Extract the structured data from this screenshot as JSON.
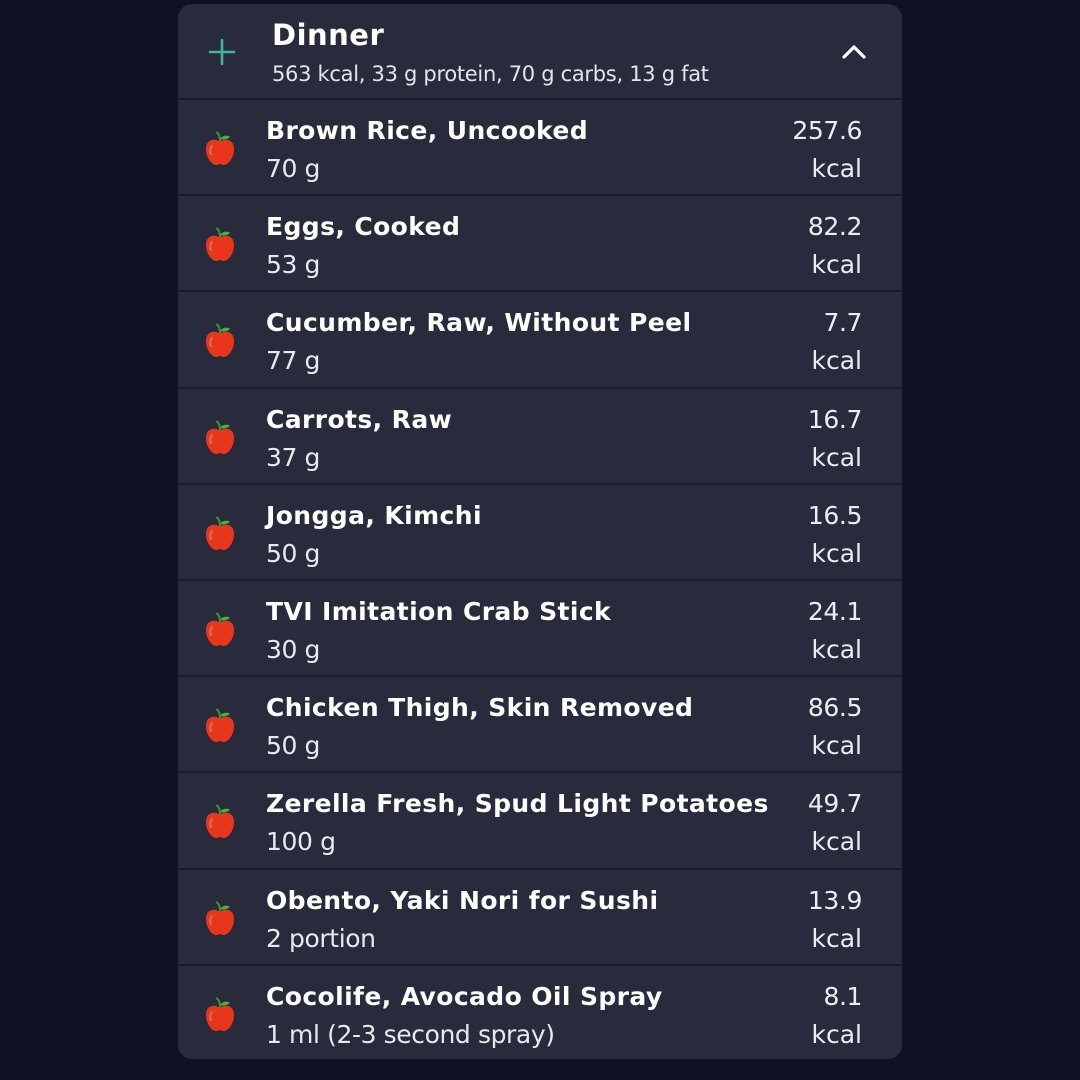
{
  "meal": {
    "title": "Dinner",
    "summary": "563 kcal, 33 g protein, 70 g carbs, 13 g fat",
    "add_icon": "plus-icon",
    "collapse_icon": "chevron-up-icon",
    "accent_color": "#3fb59b"
  },
  "foods": [
    {
      "name": "Brown Rice, Uncooked",
      "amount": "70 g",
      "kcal": "257.6",
      "unit": "kcal",
      "icon": "apple-icon"
    },
    {
      "name": "Eggs, Cooked",
      "amount": "53 g",
      "kcal": "82.2",
      "unit": "kcal",
      "icon": "apple-icon"
    },
    {
      "name": "Cucumber, Raw, Without Peel",
      "amount": "77 g",
      "kcal": "7.7",
      "unit": "kcal",
      "icon": "apple-icon"
    },
    {
      "name": "Carrots, Raw",
      "amount": "37 g",
      "kcal": "16.7",
      "unit": "kcal",
      "icon": "apple-icon"
    },
    {
      "name": "Jongga, Kimchi",
      "amount": "50 g",
      "kcal": "16.5",
      "unit": "kcal",
      "icon": "apple-icon"
    },
    {
      "name": "TVI Imitation Crab Stick",
      "amount": "30 g",
      "kcal": "24.1",
      "unit": "kcal",
      "icon": "apple-icon"
    },
    {
      "name": "Chicken Thigh, Skin Removed",
      "amount": "50 g",
      "kcal": "86.5",
      "unit": "kcal",
      "icon": "apple-icon"
    },
    {
      "name": "Zerella Fresh, Spud Light Potatoes",
      "amount": "100 g",
      "kcal": "49.7",
      "unit": "kcal",
      "icon": "apple-icon"
    },
    {
      "name": "Obento, Yaki Nori for Sushi",
      "amount": "2 portion",
      "kcal": "13.9",
      "unit": "kcal",
      "icon": "apple-icon"
    },
    {
      "name": "Cocolife, Avocado Oil Spray",
      "amount": "1 ml (2-3 second spray)",
      "kcal": "8.1",
      "unit": "kcal",
      "icon": "apple-icon"
    }
  ]
}
